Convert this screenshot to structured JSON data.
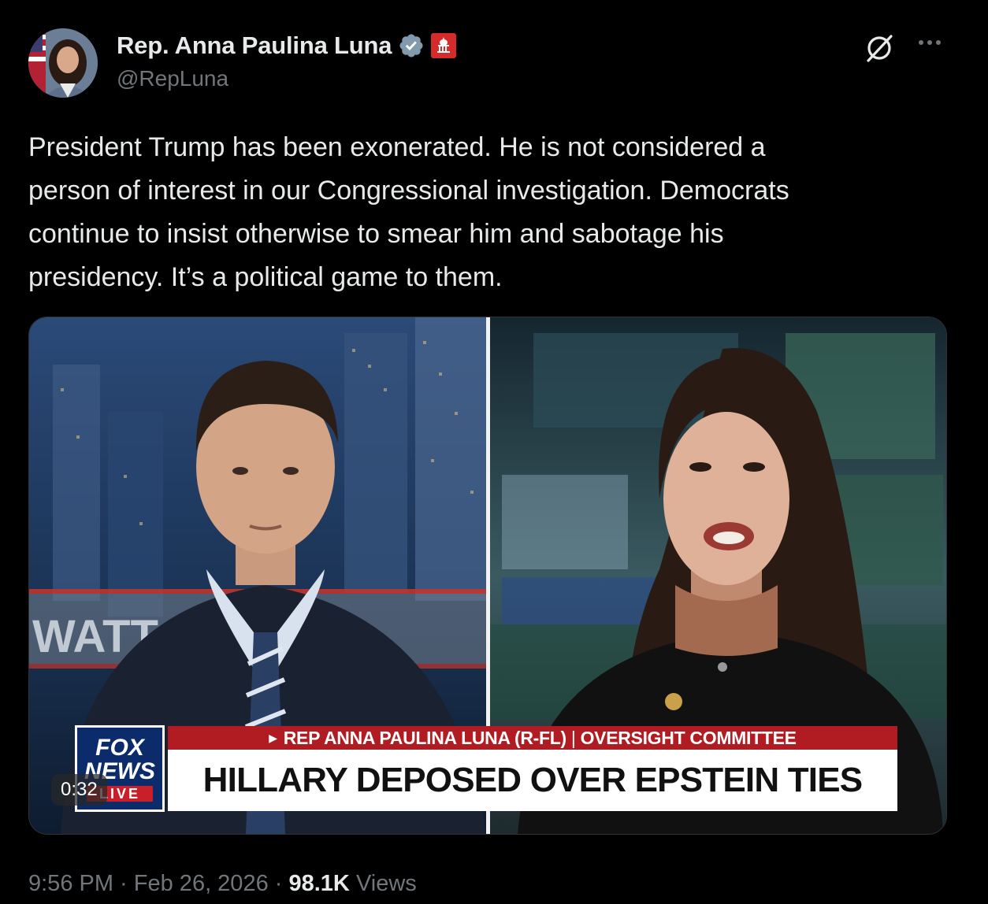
{
  "author": {
    "display_name": "Rep. Anna Paulina Luna",
    "handle": "@RepLuna",
    "verified_icon": "verified-badge-icon",
    "affiliation_icon": "capitol-gov-badge-icon"
  },
  "tweet": {
    "text": "President Trump has been exonerated. He is not considered a\nperson of interest in our Congressional investigation. Democrats\ncontinue to insist otherwise to smear him and sabotage his\npresidency. It’s a political game to them."
  },
  "video": {
    "duration": "0:32",
    "chyron_top_name": "REP ANNA PAULINA LUNA (R-FL)",
    "chyron_top_separator": "|",
    "chyron_top_role": "OVERSIGHT COMMITTEE",
    "chyron_headline": "HILLARY DEPOSED OVER EPSTEIN TIES",
    "logo_line1": "FOX",
    "logo_line2": "NEWS",
    "logo_line3": "LIVE",
    "backdrop_text": "WATT"
  },
  "meta": {
    "time": "9:56 PM",
    "separator": " · ",
    "date": "Feb 26, 2026",
    "views_count": "98.1K",
    "views_label": "Views"
  },
  "colors": {
    "background": "#000000",
    "text_primary": "#e7e9ea",
    "text_secondary": "#71767b",
    "verified_badge": "#829aab",
    "gov_badge": "#d62b2b",
    "chyron_red": "#b01c22"
  }
}
